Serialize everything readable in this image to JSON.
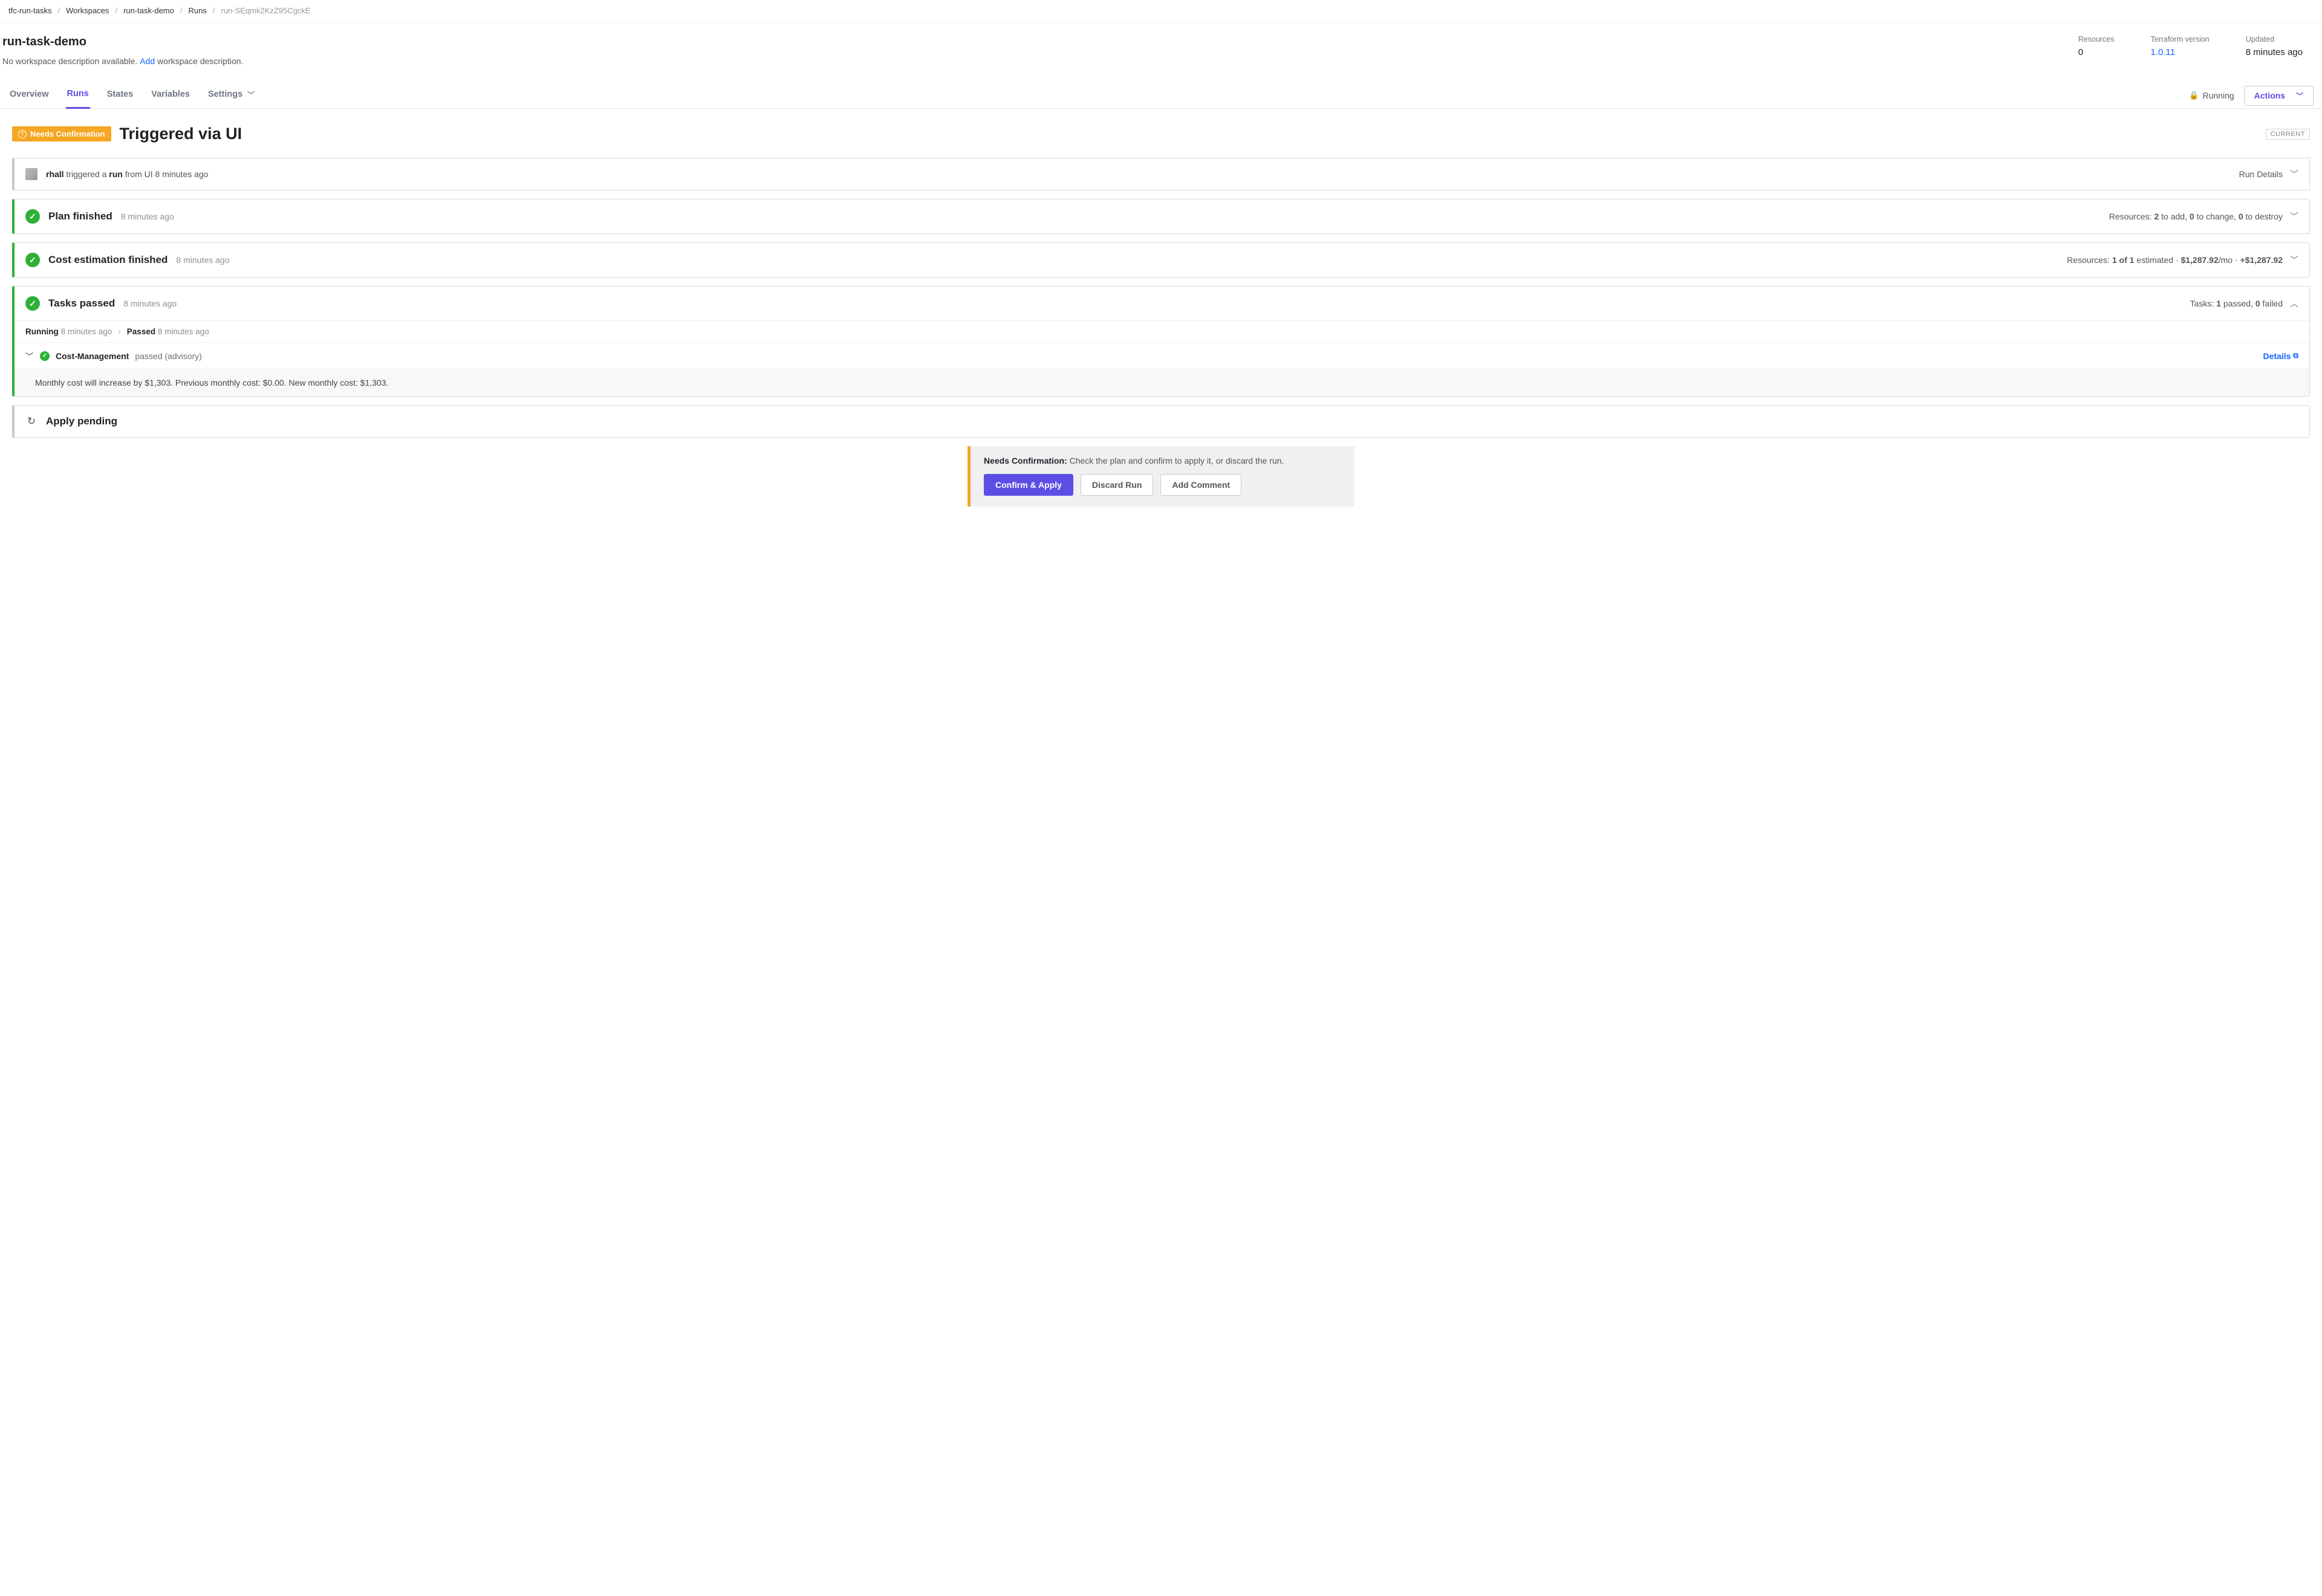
{
  "breadcrumb": {
    "org": "tfc-run-tasks",
    "workspaces": "Workspaces",
    "workspace": "run-task-demo",
    "runs": "Runs",
    "run_id": "run-SEqmk2KzZ95CgckE"
  },
  "header": {
    "title": "run-task-demo",
    "desc_prefix": "No workspace description available. ",
    "desc_add": "Add",
    "desc_suffix": " workspace description.",
    "stats": {
      "resources_label": "Resources",
      "resources_value": "0",
      "tf_label": "Terraform version",
      "tf_value": "1.0.11",
      "updated_label": "Updated",
      "updated_value": "8 minutes ago"
    }
  },
  "tabs": {
    "overview": "Overview",
    "runs": "Runs",
    "states": "States",
    "variables": "Variables",
    "settings": "Settings",
    "running_status": "Running",
    "actions": "Actions"
  },
  "run": {
    "badge": "Needs Confirmation",
    "title": "Triggered via UI",
    "current_chip": "CURRENT",
    "trigger": {
      "user": "rhall",
      "seg1": " triggered a ",
      "run_word": "run",
      "seg2": " from UI 8 minutes ago",
      "run_details": "Run Details"
    },
    "plan": {
      "title": "Plan finished",
      "time": "8 minutes ago",
      "summary_prefix": "Resources: ",
      "add_n": "2",
      "add_lbl": " to add, ",
      "change_n": "0",
      "change_lbl": " to change, ",
      "destroy_n": "0",
      "destroy_lbl": " to destroy"
    },
    "cost": {
      "title": "Cost estimation finished",
      "time": "8 minutes ago",
      "summary_prefix": "Resources: ",
      "count": "1 of 1",
      "estimated_lbl": " estimated · ",
      "monthly": "$1,287.92",
      "mo": "/mo · ",
      "delta": "+$1,287.92"
    },
    "tasks": {
      "title": "Tasks passed",
      "time": "8 minutes ago",
      "summary_prefix": "Tasks: ",
      "passed_n": "1",
      "passed_lbl": " passed, ",
      "failed_n": "0",
      "failed_lbl": " failed",
      "status1_label": "Running",
      "status1_time": " 8 minutes ago",
      "status2_label": "Passed",
      "status2_time": " 8 minutes ago",
      "item": {
        "name": "Cost-Management",
        "status": " passed (advisory)",
        "details": "Details",
        "message": "Monthly cost will increase by $1,303. Previous monthly cost: $0.00. New monthly cost: $1,303."
      }
    },
    "apply": {
      "title": "Apply pending"
    },
    "confirm": {
      "label": "Needs Confirmation:",
      "text": " Check the plan and confirm to apply it, or discard the run.",
      "apply_btn": "Confirm & Apply",
      "discard_btn": "Discard Run",
      "comment_btn": "Add Comment"
    }
  }
}
